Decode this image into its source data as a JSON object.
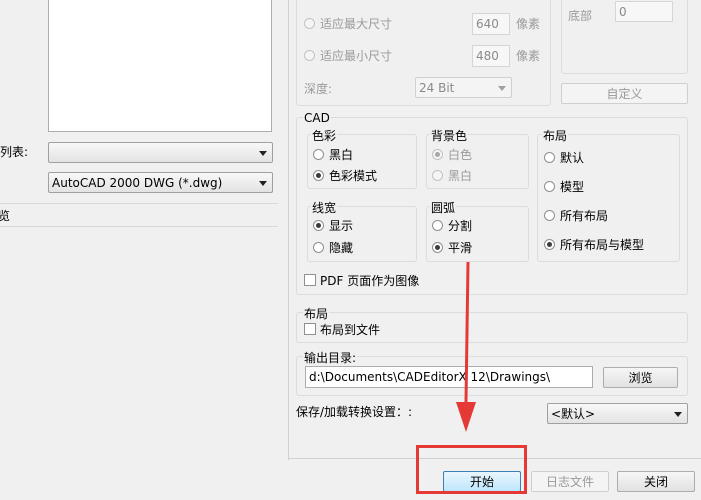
{
  "left": {
    "list_label": "列表:",
    "format_select": "AutoCAD 2000 DWG (*.dwg)",
    "browse_label": "览"
  },
  "size": {
    "fit_max": "适应最大尺寸",
    "fit_min": "适应最小尺寸",
    "max_value": "640",
    "min_value": "480",
    "unit": "像素",
    "depth_label": "深度:",
    "depth_value": "24 Bit",
    "bottom_label": "底部",
    "bottom_value": "0",
    "custom_button": "自定义"
  },
  "cad": {
    "title": "CAD",
    "color": {
      "title": "色彩",
      "options": [
        "黑白",
        "色彩模式"
      ]
    },
    "background": {
      "title": "背景色",
      "options": [
        "白色",
        "黑白"
      ]
    },
    "layout": {
      "title": "布局",
      "options": [
        "默认",
        "模型",
        "所有布局",
        "所有布局与模型"
      ]
    },
    "lineweight": {
      "title": "线宽",
      "options": [
        "显示",
        "隐藏"
      ]
    },
    "arc": {
      "title": "圆弧",
      "options": [
        "分割",
        "平滑"
      ]
    },
    "pdf_as_image": "PDF 页面作为图像"
  },
  "layout_section": {
    "title": "布局",
    "layout_to_file": "布局到文件"
  },
  "output": {
    "title": "输出目录:",
    "path": "d:\\Documents\\CADEditorX 12\\Drawings\\",
    "browse_button": "浏览"
  },
  "preset": {
    "label": "保存/加载转换设置：:",
    "value": "<默认>"
  },
  "footer": {
    "start_button": "开始",
    "log_button": "日志文件",
    "close_button": "关闭"
  },
  "annotation_color": "#e53935"
}
